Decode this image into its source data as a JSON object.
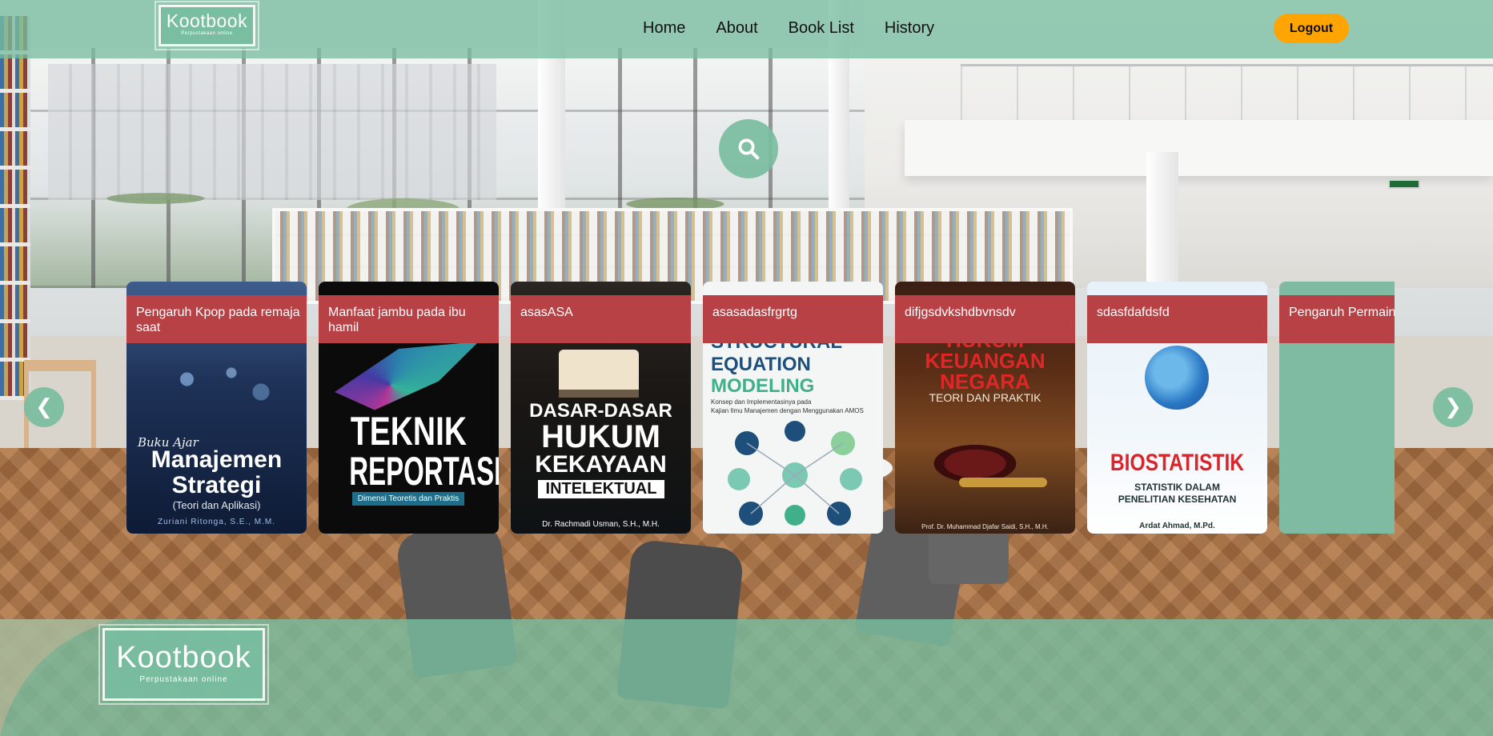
{
  "brand": {
    "name": "Kootbook",
    "tagline": "Perpustakaan online"
  },
  "nav": {
    "items": [
      "Home",
      "About",
      "Book List",
      "History"
    ]
  },
  "header": {
    "logout_label": "Logout"
  },
  "colors": {
    "primary": "#79bda0",
    "accent": "#ffa400",
    "card_title_bg": "#b74144"
  },
  "search": {
    "icon": "search-icon"
  },
  "carousel": {
    "prev_label": "❮",
    "next_label": "❯",
    "books": [
      {
        "title": "Pengaruh Kpop pada remaja saat",
        "cover": {
          "l1": "Buku Ajar",
          "l2": "Manajemen",
          "l3": "Strategi",
          "l4": "(Teori dan Aplikasi)",
          "l5": "Zuriani Ritonga, S.E., M.M."
        }
      },
      {
        "title": "Manfaat jambu pada ibu hamil",
        "cover": {
          "l1": "TEKNIK",
          "l2": "REPORTASE",
          "l3": "Dimensi Teoretis dan Praktis"
        }
      },
      {
        "title": "asasASA",
        "cover": {
          "l1": "DASAR-DASAR",
          "l2": "HUKUM",
          "l3": "KEKAYAAN",
          "l4": "INTELEKTUAL",
          "l5": "Dr. Rachmadi Usman, S.H., M.H."
        }
      },
      {
        "title": "asasadasfrgrtg",
        "cover": {
          "l1": "STRUCTURAL",
          "l2": "EQUATION",
          "l3": "MODELING",
          "l4": "Konsep dan Implementasinya pada",
          "l5": "Kajian Ilmu Manajemen dengan Menggunakan AMOS"
        }
      },
      {
        "title": "difjgsdvkshdbvnsdv",
        "cover": {
          "l1": "HUKUM",
          "l2": "KEUANGAN",
          "l3": "NEGARA",
          "l4": "TEORI DAN PRAKTIK",
          "l5": "Prof. Dr. Muhammad Djafar Saidi, S.H., M.H."
        }
      },
      {
        "title": "sdasfdafdsfd",
        "cover": {
          "l1": "BIOSTATISTIK",
          "l2": "STATISTIK DALAM",
          "l3": "PENELITIAN KESEHATAN",
          "l4": "Ardat Ahmad, M.Pd."
        }
      },
      {
        "title": "Pengaruh Permainan Angka"
      }
    ]
  }
}
